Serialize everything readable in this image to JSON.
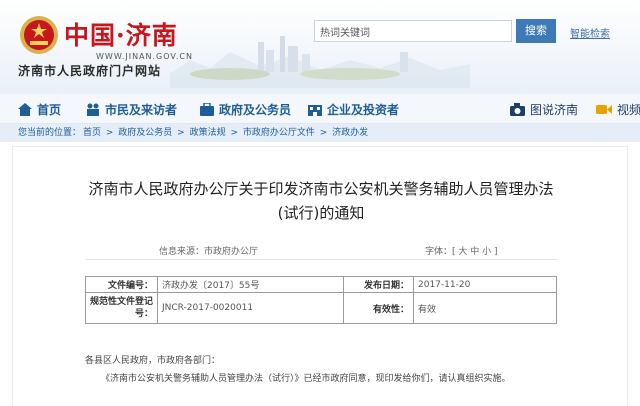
{
  "header": {
    "brand": "中国·济南",
    "domain": "WWW.JINAN.GOV.CN",
    "portal_name": "济南市人民政府门户网站",
    "search": {
      "value": "热词关键词",
      "button": "搜索"
    },
    "smart_search": "智能检索"
  },
  "nav": {
    "home": "首页",
    "citizen": "市民及来访者",
    "gov": "政府及公务员",
    "biz": "企业及投资者",
    "photo": "图说济南",
    "video": "视频"
  },
  "breadcrumb": {
    "prefix": "您当前的位置：",
    "items": [
      "首页",
      "政府及公务员",
      "政策法规",
      "市政府办公厅文件",
      "济政办发"
    ],
    "sep": " > "
  },
  "article": {
    "title_line1": "济南市人民政府办公厅关于印发济南市公安机关警务辅助人员管理办法",
    "title_line2": "(试行)的通知",
    "source": "信息来源：市政府办公厅",
    "font_size_ctrl": "字体：[ 大 中 小 ]",
    "info": {
      "doc_no_label": "文件编号：",
      "doc_no": "济政办发〔2017〕55号",
      "date_label": "发布日期：",
      "date": "2017-11-20",
      "reg_label": "规范性文件登记号：",
      "reg_no": "JNCR-2017-0020011",
      "valid_label": "有效性：",
      "valid": "有效"
    },
    "para1": "各县区人民政府，市政府各部门：",
    "para2": "《济南市公安机关警务辅助人员管理办法（试行）》已经市政府同意，现印发给你们，请认真组织实施。"
  },
  "colors": {
    "brand": "#c8161d",
    "nav": "#1f5d99",
    "search_button": "#3e79b8"
  }
}
